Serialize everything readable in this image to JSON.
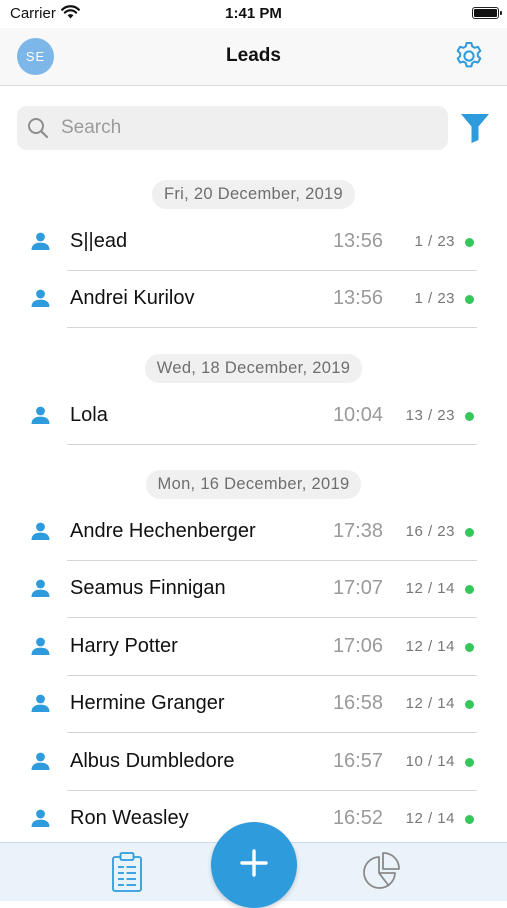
{
  "status_bar": {
    "carrier": "Carrier",
    "time": "1:41 PM"
  },
  "nav": {
    "avatar_initials": "SE",
    "title": "Leads"
  },
  "search": {
    "placeholder": "Search",
    "value": ""
  },
  "colors": {
    "accent": "#2d9bdc",
    "online": "#34c759",
    "tabbar": "#eaf2fa"
  },
  "icons": {
    "settings": "gear-icon",
    "filter": "filter-icon",
    "search": "search-icon",
    "lead": "person-icon",
    "tab_leads": "clipboard-icon",
    "tab_stats": "pie-chart-icon",
    "add": "plus-icon"
  },
  "sections": [
    {
      "date": "Fri, 20 December, 2019",
      "leads": [
        {
          "name": "S||ead",
          "time": "13:56",
          "count": "1 / 23"
        },
        {
          "name": "Andrei Kurilov",
          "time": "13:56",
          "count": "1 / 23"
        }
      ]
    },
    {
      "date": "Wed, 18 December, 2019",
      "leads": [
        {
          "name": "Lola",
          "time": "10:04",
          "count": "13 / 23"
        }
      ]
    },
    {
      "date": "Mon, 16 December, 2019",
      "leads": [
        {
          "name": "Andre Hechenberger",
          "time": "17:38",
          "count": "16 / 23"
        },
        {
          "name": "Seamus Finnigan",
          "time": "17:07",
          "count": "12 / 14"
        },
        {
          "name": "Harry Potter",
          "time": "17:06",
          "count": "12 / 14"
        },
        {
          "name": "Hermine Granger",
          "time": "16:58",
          "count": "12 / 14"
        },
        {
          "name": "Albus Dumbledore",
          "time": "16:57",
          "count": "10 / 14"
        },
        {
          "name": "Ron Weasley",
          "time": "16:52",
          "count": "12 / 14"
        }
      ]
    }
  ]
}
